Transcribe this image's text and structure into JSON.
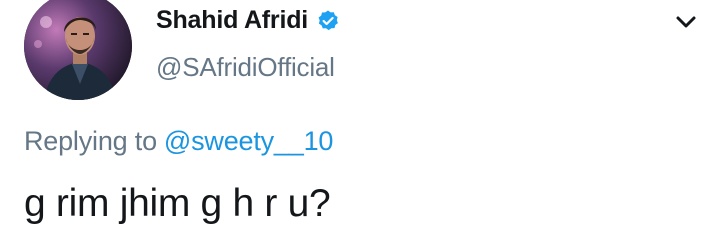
{
  "tweet": {
    "author": {
      "name": "Shahid Afridi",
      "handle": "@SAfridiOfficial",
      "verified": true
    },
    "reply": {
      "prefix": "Replying to",
      "mention": "@sweety__10"
    },
    "text": "g rim jhim g h r u?",
    "menu_icon": "chevron-down-icon",
    "avatar_icon": "profile-photo"
  },
  "colors": {
    "name": "#14171a",
    "secondary": "#657786",
    "link": "#1b95e0",
    "verified": "#1da1f2"
  }
}
